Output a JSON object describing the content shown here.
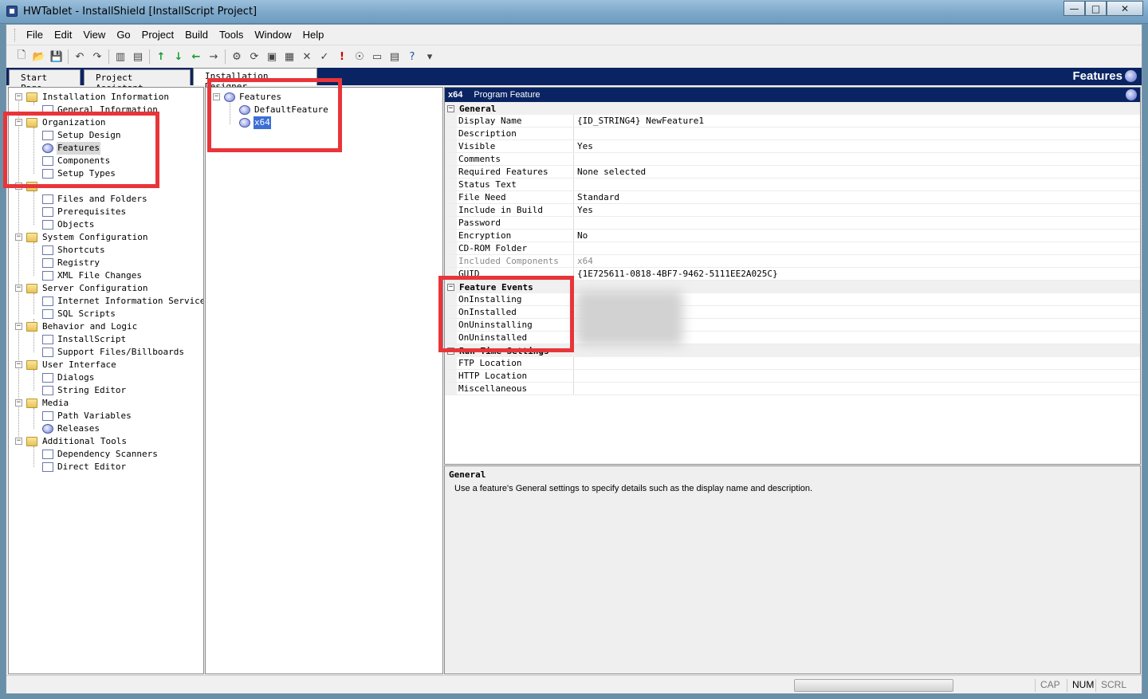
{
  "window": {
    "title": "HWTablet - InstallShield [InstallScript Project]",
    "controls": {
      "minimize": "—",
      "maximize": "□",
      "close": "✕"
    }
  },
  "menu": [
    "File",
    "Edit",
    "View",
    "Go",
    "Project",
    "Build",
    "Tools",
    "Window",
    "Help"
  ],
  "toolbar_icons": [
    "new-icon",
    "open-icon",
    "save-icon",
    "undo-icon",
    "redo-icon",
    "layout-icon",
    "layout-alt-icon",
    "arrow-up-icon",
    "arrow-down-icon",
    "arrow-left-icon",
    "arrow-right-icon",
    "compile-icon",
    "build-icon",
    "run-icon",
    "test-icon",
    "stop-icon",
    "validate-icon",
    "alert-icon",
    "settings-icon",
    "help-icon",
    "dropdown-icon"
  ],
  "tabs": {
    "start_page": "Start Page",
    "project_assistant": "Project Assistant",
    "installation_designer": "Installation Designer",
    "view_title": "Features"
  },
  "tree": {
    "installation_information": "Installation Information",
    "general_information": "General Information",
    "organization": "Organization",
    "setup_design": "Setup Design",
    "features": "Features",
    "components": "Components",
    "setup_types": "Setup Types",
    "files_and_folders": "Files and Folders",
    "prerequisites": "Prerequisites",
    "objects": "Objects",
    "system_configuration": "System Configuration",
    "shortcuts": "Shortcuts",
    "registry": "Registry",
    "xml_file_changes": "XML File Changes",
    "server_configuration": "Server Configuration",
    "iis": "Internet Information Services",
    "sql_scripts": "SQL Scripts",
    "behavior_and_logic": "Behavior and Logic",
    "installscript": "InstallScript",
    "support_files": "Support Files/Billboards",
    "user_interface": "User Interface",
    "dialogs": "Dialogs",
    "string_editor": "String Editor",
    "media": "Media",
    "path_variables": "Path Variables",
    "releases": "Releases",
    "additional_tools": "Additional Tools",
    "dependency_scanners": "Dependency Scanners",
    "direct_editor": "Direct Editor"
  },
  "feature_tree": {
    "root": "Features",
    "default_feature": "DefaultFeature",
    "x64": "x64"
  },
  "properties": {
    "header_id": "x64",
    "header_type": "Program Feature",
    "general": "General",
    "display_name": {
      "name": "Display Name",
      "value": "{ID_STRING4} NewFeature1"
    },
    "description": {
      "name": "Description",
      "value": ""
    },
    "visible": {
      "name": "Visible",
      "value": "Yes"
    },
    "comments": {
      "name": "Comments",
      "value": ""
    },
    "required_features": {
      "name": "Required Features",
      "value": "None selected"
    },
    "status_text": {
      "name": "Status Text",
      "value": ""
    },
    "file_need": {
      "name": "File Need",
      "value": "Standard"
    },
    "include_in_build": {
      "name": "Include in Build",
      "value": "Yes"
    },
    "password": {
      "name": "Password",
      "value": ""
    },
    "encryption": {
      "name": "Encryption",
      "value": "No"
    },
    "cdrom_folder": {
      "name": "CD-ROM Folder",
      "value": ""
    },
    "included_components": {
      "name": "Included Components",
      "value": "x64"
    },
    "guid": {
      "name": "GUID",
      "value": "{1E725611-0818-4BF7-9462-5111EE2A025C}"
    },
    "feature_events": "Feature Events",
    "on_installing": {
      "name": "OnInstalling",
      "value": ""
    },
    "on_installed": {
      "name": "OnInstalled",
      "value": ""
    },
    "on_uninstalling": {
      "name": "OnUninstalling",
      "value": ""
    },
    "on_uninstalled": {
      "name": "OnUninstalled",
      "value": ""
    },
    "run_time_settings": "Run-Time Settings",
    "ftp_location": {
      "name": "FTP Location",
      "value": ""
    },
    "http_location": {
      "name": "HTTP Location",
      "value": ""
    },
    "miscellaneous": {
      "name": "Miscellaneous",
      "value": ""
    }
  },
  "help": {
    "title": "General",
    "text": "Use a feature's General settings to specify details such as the display name and description."
  },
  "status": {
    "cap": "CAP",
    "num": "NUM",
    "scrl": "SCRL"
  },
  "colors": {
    "header_navy": "#0a2463",
    "selection_blue": "#3b6fd6",
    "annotation_red": "#e8353a"
  }
}
